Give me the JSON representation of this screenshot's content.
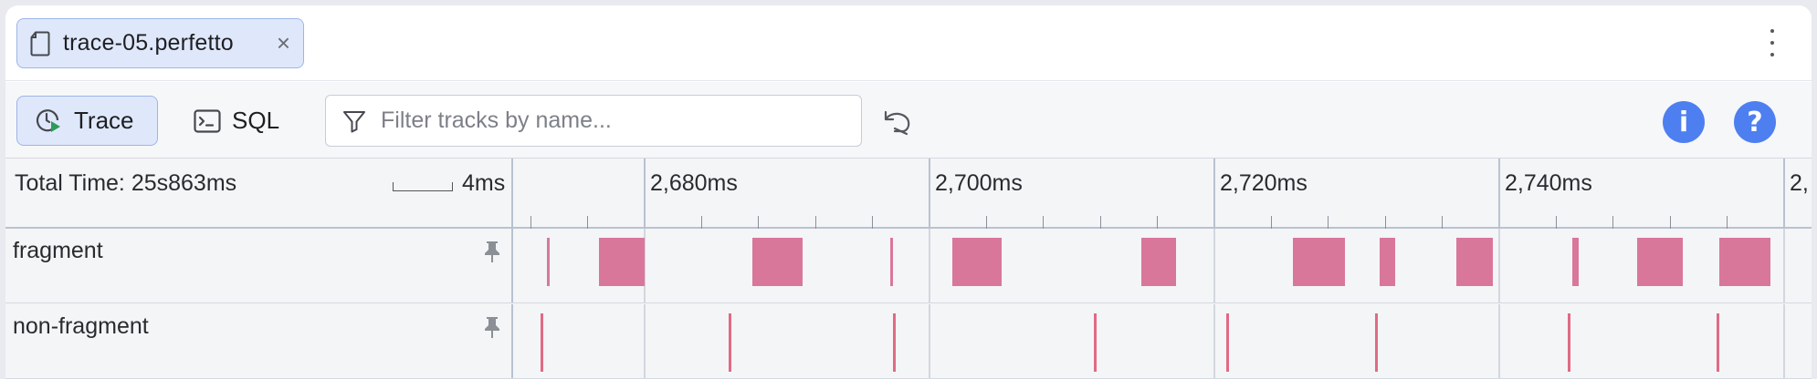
{
  "tab": {
    "title": "trace-05.perfetto",
    "close_glyph": "×",
    "icon": "file-icon"
  },
  "toolbar": {
    "trace_label": "Trace",
    "sql_label": "SQL",
    "filter_placeholder": "Filter tracks by name...",
    "filter_value": "",
    "info_glyph": "i",
    "help_glyph": "?"
  },
  "timeline": {
    "total_time": "Total Time: 25s863ms",
    "scale_label": "4ms",
    "markers": [
      "2,680ms",
      "2,700ms",
      "2,720ms",
      "2,740ms",
      "2,"
    ]
  },
  "tracks": [
    {
      "name": "fragment"
    },
    {
      "name": "non-fragment"
    }
  ],
  "colors": {
    "accent": "#4d7ff0",
    "tab_bg": "#dfe8fb",
    "slice": "#d9779a",
    "instant": "#e06a84"
  },
  "chart_data": {
    "type": "timeline",
    "x_unit": "ms",
    "x_range": [
      2671.6,
      2756.4
    ],
    "tracks": [
      {
        "name": "fragment",
        "slices": [
          [
            2673.8,
            2674.0
          ],
          [
            2677.2,
            2680.2
          ],
          [
            2687.2,
            2690.5
          ],
          [
            2696.2,
            2696.4
          ],
          [
            2700.3,
            2703.5
          ],
          [
            2712.6,
            2714.9
          ],
          [
            2722.5,
            2725.9
          ],
          [
            2728.2,
            2729.2
          ],
          [
            2733.2,
            2735.6
          ],
          [
            2740.8,
            2741.2
          ],
          [
            2745.0,
            2748.0
          ],
          [
            2750.4,
            2753.7
          ]
        ]
      },
      {
        "name": "non-fragment",
        "instants": [
          2673.4,
          2685.7,
          2696.4,
          2709.5,
          2718.2,
          2727.9,
          2740.5,
          2750.2
        ]
      }
    ]
  }
}
